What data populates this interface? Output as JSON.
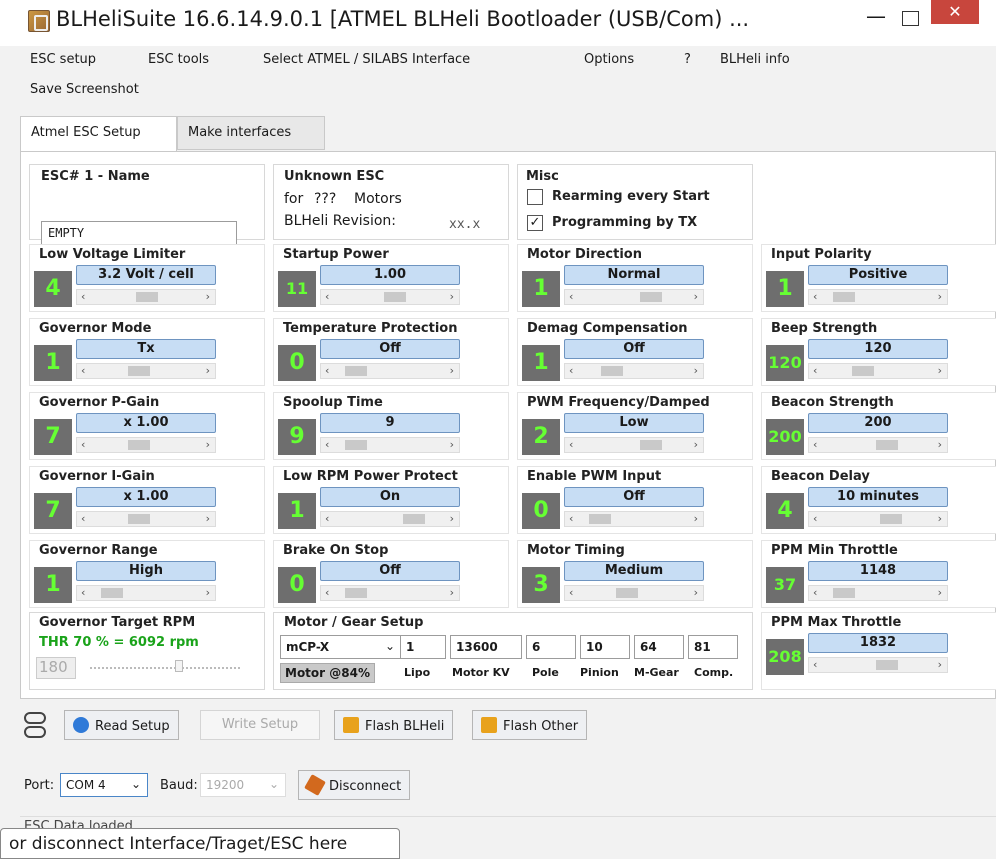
{
  "window": {
    "title": "BLHeliSuite 16.6.14.9.0.1  [ATMEL BLHeli Bootloader (USB/Com) ...",
    "min_glyph": "—",
    "close_glyph": "✕"
  },
  "menu": {
    "esc_setup": "ESC setup",
    "esc_tools": "ESC tools",
    "select_interface": "Select ATMEL / SILABS Interface",
    "options": "Options",
    "help": "?",
    "blheli_info": "BLHeli info",
    "save_screenshot": "Save Screenshot"
  },
  "tabs": [
    {
      "label": "Atmel ESC Setup",
      "active": true
    },
    {
      "label": "Make interfaces",
      "active": false
    }
  ],
  "esc_name": {
    "label": "ESC# 1 - Name",
    "value": "EMPTY"
  },
  "esc_info": {
    "title": "Unknown ESC",
    "for_label": "for",
    "motors_value": "???",
    "motors_label": "Motors",
    "revision_label": "BLHeli Revision:",
    "revision_value": "xx.x"
  },
  "misc": {
    "title": "Misc",
    "rearming_label": "Rearming every Start",
    "rearming_checked": false,
    "programming_label": "Programming by TX",
    "programming_checked": true,
    "check_glyph": "✓"
  },
  "settings": [
    {
      "label": "Low Voltage Limiter",
      "value": "3.2 Volt / cell",
      "num": "4",
      "slider": 0.55
    },
    {
      "label": "Startup Power",
      "value": "1.00",
      "num": "11",
      "slider": 0.6
    },
    {
      "label": "Motor Direction",
      "value": "Normal",
      "num": "1",
      "slider": 0.75
    },
    {
      "label": "Input Polarity",
      "value": "Positive",
      "num": "1",
      "slider": 0.1
    },
    {
      "label": "Governor Mode",
      "value": "Tx",
      "num": "1",
      "slider": 0.45
    },
    {
      "label": "Temperature Protection",
      "value": "Off",
      "num": "0",
      "slider": 0.1
    },
    {
      "label": "Demag Compensation",
      "value": "Off",
      "num": "1",
      "slider": 0.25
    },
    {
      "label": "Beep Strength",
      "value": "120",
      "num": "120",
      "slider": 0.35
    },
    {
      "label": "Governor P-Gain",
      "value": "x 1.00",
      "num": "7",
      "slider": 0.45
    },
    {
      "label": "Spoolup Time",
      "value": "9",
      "num": "9",
      "slider": 0.1
    },
    {
      "label": "PWM Frequency/Damped",
      "value": "Low",
      "num": "2",
      "slider": 0.75
    },
    {
      "label": "Beacon Strength",
      "value": "200",
      "num": "200",
      "slider": 0.65
    },
    {
      "label": "Governor I-Gain",
      "value": "x 1.00",
      "num": "7",
      "slider": 0.45
    },
    {
      "label": "Low RPM Power Protect",
      "value": "On",
      "num": "1",
      "slider": 0.85
    },
    {
      "label": "Enable PWM Input",
      "value": "Off",
      "num": "0",
      "slider": 0.1
    },
    {
      "label": "Beacon Delay",
      "value": "10 minutes",
      "num": "4",
      "slider": 0.7
    },
    {
      "label": "Governor Range",
      "value": "High",
      "num": "1",
      "slider": 0.1
    },
    {
      "label": "Brake On Stop",
      "value": "Off",
      "num": "0",
      "slider": 0.1
    },
    {
      "label": "Motor Timing",
      "value": "Medium",
      "num": "3",
      "slider": 0.45
    },
    {
      "label": "PPM Min Throttle",
      "value": "1148",
      "num": "37",
      "slider": 0.1
    },
    {
      "label": "PPM Max Throttle",
      "value": "1832",
      "num": "208",
      "slider": 0.65
    }
  ],
  "governor_target": {
    "label": "Governor Target RPM",
    "value": "THR 70 % = 6092 rpm",
    "num": "180"
  },
  "motor_gear": {
    "title": "Motor / Gear Setup",
    "model": "mCP-X",
    "lipo": "1",
    "kv": "13600",
    "pole": "6",
    "pinion": "10",
    "mgear": "64",
    "comp": "81",
    "motor_pct": "Motor @84%",
    "lipo_label": "Lipo",
    "kv_label": "Motor KV",
    "pole_label": "Pole",
    "pinion_label": "Pinion",
    "mgear_label": "M-Gear",
    "comp_label": "Comp."
  },
  "toolbar": {
    "read_setup": "Read Setup",
    "write_setup": "Write Setup",
    "flash_blheli": "Flash BLHeli",
    "flash_other": "Flash Other"
  },
  "port": {
    "port_label": "Port:",
    "port_value": "COM 4",
    "baud_label": "Baud:",
    "baud_value": "19200",
    "disconnect": "Disconnect"
  },
  "status": {
    "partial_text": "ESC Data loaded",
    "tooltip": "or disconnect Interface/Traget/ESC here"
  },
  "colors": {
    "value_bar": "#c7ddf4",
    "number_box": "#6e6e6e",
    "number_text": "#66ff33",
    "close_button": "#c8463d",
    "governor_target_text": "#1aa31a"
  }
}
